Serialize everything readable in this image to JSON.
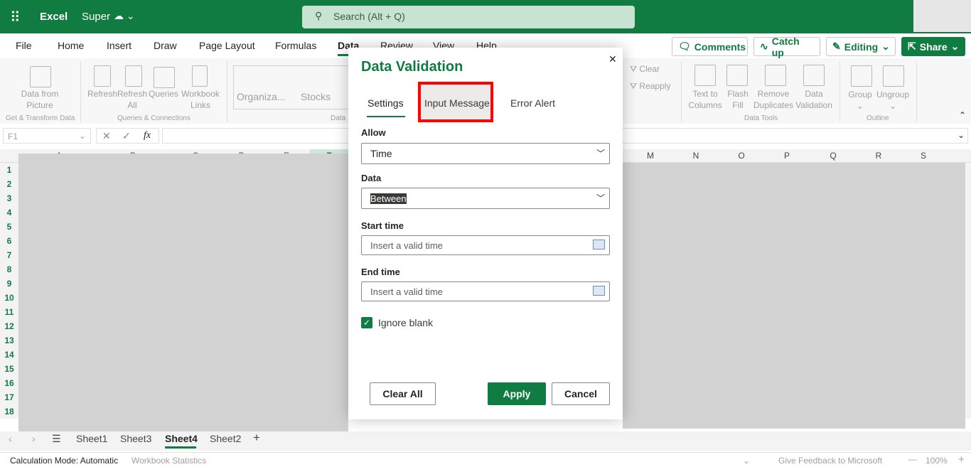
{
  "app": {
    "name": "Excel",
    "file_name": "Super",
    "search_placeholder": "Search (Alt + Q)"
  },
  "tabs": [
    "File",
    "Home",
    "Insert",
    "Draw",
    "Page Layout",
    "Formulas",
    "Data",
    "Review",
    "View",
    "Help"
  ],
  "active_tab": "Data",
  "header_buttons": {
    "comments": "Comments",
    "catch_up": "Catch up",
    "editing": "Editing",
    "share": "Share"
  },
  "ribbon": {
    "data_from_picture": "Data from Picture",
    "refresh": "Refresh",
    "refresh_all": "Refresh All",
    "queries": "Queries",
    "workbook_links": "Workbook Links",
    "organization": "Organiza...",
    "stocks": "Stocks",
    "clear": "Clear",
    "reapply": "Reapply",
    "text_to_columns": "Text to Columns",
    "flash_fill": "Flash Fill",
    "remove_duplicates": "Remove Duplicates",
    "data_validation": "Data Validation",
    "group": "Group",
    "ungroup": "Ungroup",
    "groups": {
      "get_transform": "Get & Transform Data",
      "queries_connections": "Queries & Connections",
      "data_types": "Data",
      "data_tools": "Data Tools",
      "outline": "Outline"
    }
  },
  "formula_bar": {
    "name_box": "F1",
    "fx": "fx",
    "value": ""
  },
  "columns_left": [
    "A",
    "B",
    "C",
    "D",
    "E",
    "F"
  ],
  "columns_right": [
    "M",
    "N",
    "O",
    "P",
    "Q",
    "R",
    "S"
  ],
  "rows": [
    "1",
    "2",
    "3",
    "4",
    "5",
    "6",
    "7",
    "8",
    "9",
    "10",
    "11",
    "12",
    "13",
    "14",
    "15",
    "16",
    "17",
    "18"
  ],
  "sheets": [
    "Sheet1",
    "Sheet3",
    "Sheet4",
    "Sheet2"
  ],
  "active_sheet": "Sheet4",
  "status": {
    "calc_mode": "Calculation Mode: Automatic",
    "workbook_stats": "Workbook Statistics",
    "feedback": "Give Feedback to Microsoft",
    "zoom": "100%"
  },
  "dialog": {
    "title": "Data Validation",
    "tabs": [
      "Settings",
      "Input Message",
      "Error Alert"
    ],
    "active_tab": "Settings",
    "highlighted_tab": "Input Message",
    "allow_label": "Allow",
    "allow_value": "Time",
    "data_label": "Data",
    "data_value": "Between",
    "start_label": "Start time",
    "start_placeholder": "Insert a valid time",
    "end_label": "End time",
    "end_placeholder": "Insert a valid time",
    "ignore_blank": "Ignore blank",
    "ignore_blank_checked": true,
    "clear_all": "Clear All",
    "apply": "Apply",
    "cancel": "Cancel"
  },
  "colors": {
    "brand": "#107c41",
    "highlight": "#ff0000"
  }
}
